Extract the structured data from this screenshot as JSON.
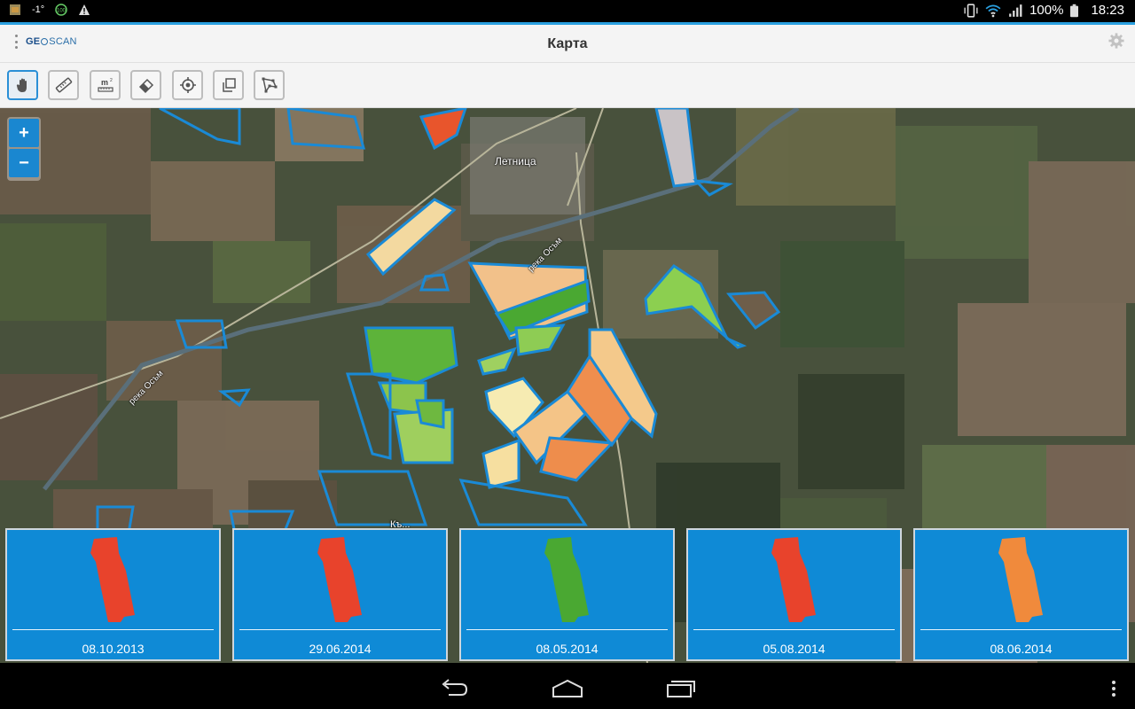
{
  "status_bar": {
    "temperature": "-1°",
    "battery": "100%",
    "time": "18:23",
    "icons": [
      "app-icon",
      "temperature-icon",
      "badge-icon",
      "warning-icon",
      "vibrate-icon",
      "wifi-icon",
      "signal-icon",
      "battery-icon"
    ]
  },
  "header": {
    "logo_text_a": "GE",
    "logo_text_b": "SCAN",
    "title": "Карта",
    "settings_icon": "gear-icon"
  },
  "toolbar": {
    "tools": [
      {
        "name": "pan",
        "icon": "hand-icon",
        "active": true
      },
      {
        "name": "measure-distance",
        "icon": "ruler-icon",
        "active": false
      },
      {
        "name": "measure-area",
        "icon": "area-m2-icon",
        "active": false
      },
      {
        "name": "erase",
        "icon": "eraser-icon",
        "active": false
      },
      {
        "name": "locate",
        "icon": "crosshair-icon",
        "active": false
      },
      {
        "name": "copy",
        "icon": "copy-icon",
        "active": false
      },
      {
        "name": "polygon",
        "icon": "polygon-icon",
        "active": false
      }
    ]
  },
  "map": {
    "zoom_in_label": "+",
    "zoom_out_label": "−",
    "labels": {
      "town": "Летница",
      "river_1": "река Осъм",
      "river_2": "река Осъм",
      "bottom_town": "Къ..."
    }
  },
  "thumbnails": [
    {
      "date": "08.10.2013",
      "color": "#e8432c"
    },
    {
      "date": "29.06.2014",
      "color": "#e8432c"
    },
    {
      "date": "08.05.2014",
      "color": "#4aa832"
    },
    {
      "date": "05.08.2014",
      "color": "#e8432c"
    },
    {
      "date": "08.06.2014",
      "color": "#f08a3c"
    }
  ],
  "colors": {
    "accent": "#2aa0e0",
    "field_outline": "#1a8ad6",
    "thumb_bg": "#0f8ad6"
  }
}
